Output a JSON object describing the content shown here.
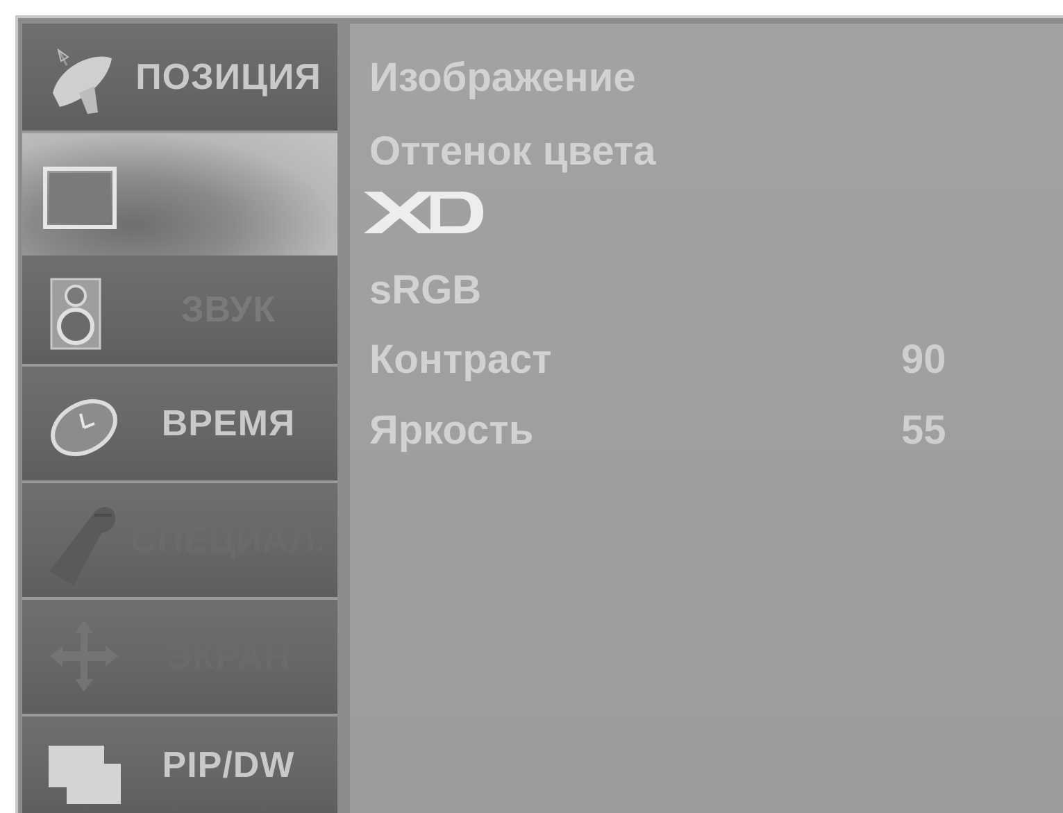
{
  "sidebar": {
    "items": [
      {
        "label": "ПОЗИЦИЯ",
        "icon": "satellite-dish-icon"
      },
      {
        "label": "",
        "icon": "picture-screen-icon"
      },
      {
        "label": "ЗВУК",
        "icon": "speaker-icon"
      },
      {
        "label": "ВРЕМЯ",
        "icon": "clock-icon"
      },
      {
        "label": "СПЕЦИАЛ.",
        "icon": "key-icon"
      },
      {
        "label": "ЭКРАН",
        "icon": "move-arrows-icon"
      },
      {
        "label": "PIP/DW",
        "icon": "pip-icon"
      }
    ],
    "selected_index": 1
  },
  "menu": {
    "items": [
      {
        "label": "Изображение"
      },
      {
        "label": "Оттенок цвета"
      },
      {
        "label": "XD",
        "logo": true
      },
      {
        "label": "sRGB"
      },
      {
        "label": "Контраст",
        "value": "90"
      },
      {
        "label": "Яркость",
        "value": "55"
      }
    ]
  }
}
